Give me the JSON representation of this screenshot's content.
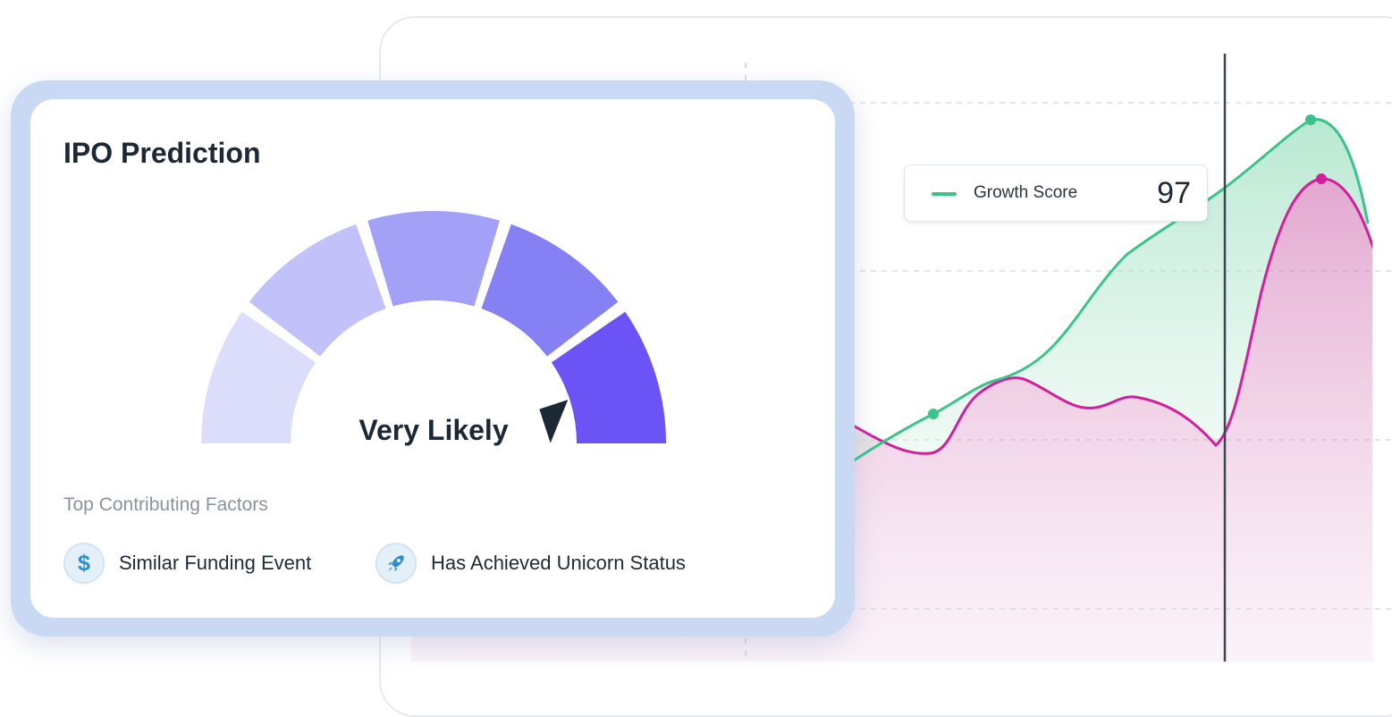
{
  "card": {
    "title": "IPO Prediction",
    "gauge": {
      "label": "Very Likely",
      "level": 5,
      "segments": 5,
      "colors": [
        "#dcdcfb",
        "#c2c1fa",
        "#a3a1f7",
        "#8581f5",
        "#6b53f5"
      ],
      "pointer_color": "#1d2836"
    },
    "factors_heading": "Top Contributing Factors",
    "factors": [
      {
        "label": "Similar Funding Event",
        "icon": "dollar-icon"
      },
      {
        "label": "Has Achieved Unicorn Status",
        "icon": "rocket-icon"
      }
    ]
  },
  "chart": {
    "legend": {
      "label": "Growth Score",
      "value": "97"
    },
    "colors": {
      "growth": "#3cc38c",
      "secondary": "#d1209a"
    }
  }
}
